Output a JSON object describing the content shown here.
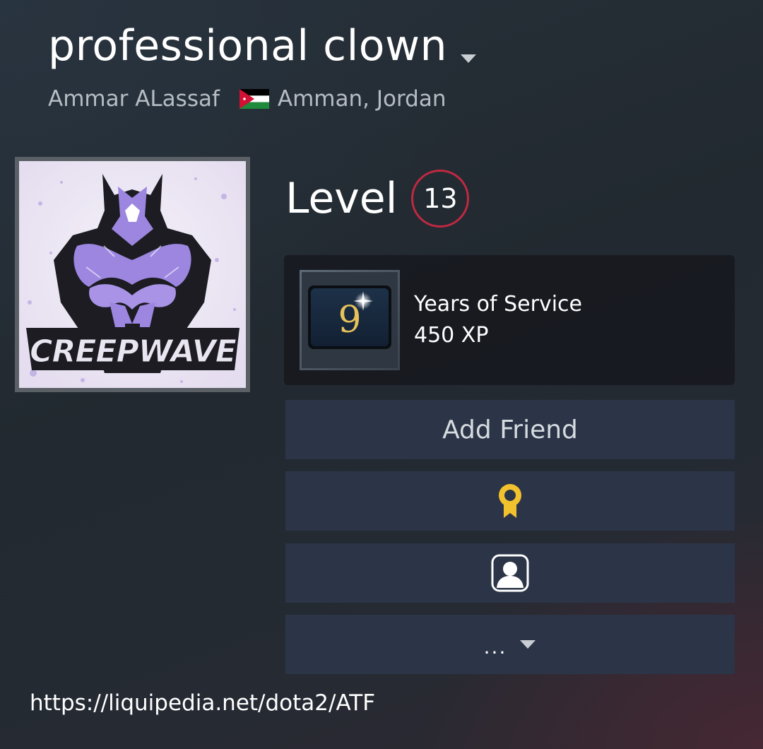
{
  "profile": {
    "persona_name": "professional clown",
    "real_name": "Ammar ALassaf",
    "location": "Amman, Jordan",
    "flag_icon": "jordan-flag-icon",
    "avatar_logo_text": "CREEPWAVE"
  },
  "level": {
    "label": "Level",
    "value": "13",
    "ring_color": "#c02942"
  },
  "badge": {
    "icon_text": "9",
    "name": "Years of Service",
    "xp": "450 XP"
  },
  "actions": {
    "add_friend_label": "Add Friend",
    "award_icon": "award-ribbon-icon",
    "award_color": "#f2c12e",
    "profile_icon": "user-profile-icon",
    "more_label": "...",
    "more_caret_icon": "chevron-down-icon"
  },
  "overlay": {
    "url": "https://liquipedia.net/dota2/ATF"
  },
  "colors": {
    "button_bg": "#2b3547",
    "badge_box_bg": "#17151c",
    "secondary_text": "#b6bcc3"
  }
}
